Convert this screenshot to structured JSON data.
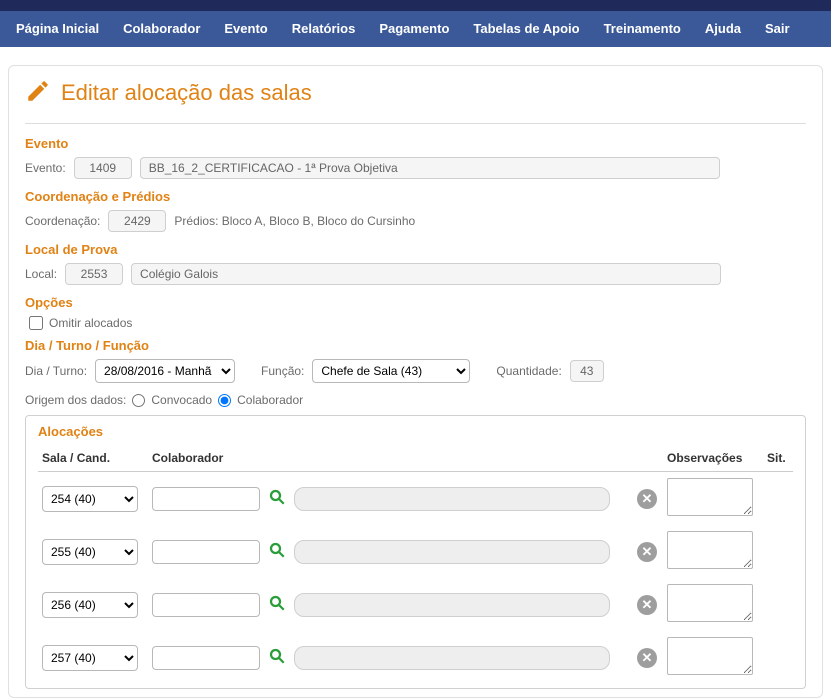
{
  "nav": {
    "items": [
      {
        "label": "Página Inicial"
      },
      {
        "label": "Colaborador"
      },
      {
        "label": "Evento"
      },
      {
        "label": "Relatórios"
      },
      {
        "label": "Pagamento"
      },
      {
        "label": "Tabelas de Apoio"
      },
      {
        "label": "Treinamento"
      },
      {
        "label": "Ajuda"
      },
      {
        "label": "Sair"
      }
    ]
  },
  "page": {
    "title": "Editar alocação das salas"
  },
  "evento": {
    "section": "Evento",
    "label": "Evento:",
    "id": "1409",
    "nome": "BB_16_2_CERTIFICACAO - 1ª Prova Objetiva"
  },
  "coord": {
    "section": "Coordenação e Prédios",
    "label": "Coordenação:",
    "id": "2429",
    "predios_label": "Prédios: Bloco A, Bloco B, Bloco do Cursinho"
  },
  "local": {
    "section": "Local de Prova",
    "label": "Local:",
    "id": "2553",
    "nome": "Colégio Galois"
  },
  "opcoes": {
    "section": "Opções",
    "omitir_label": "Omitir alocados"
  },
  "dia_turno": {
    "section": "Dia / Turno / Função",
    "label": "Dia / Turno:",
    "value": "28/08/2016 - Manhã",
    "funcao_label": "Função:",
    "funcao_value": "Chefe de Sala (43)",
    "qtd_label": "Quantidade:",
    "qtd_value": "43"
  },
  "origem": {
    "label": "Origem dos dados:",
    "opt1": "Convocado",
    "opt2": "Colaborador"
  },
  "alloc": {
    "title": "Alocações",
    "headers": {
      "sala": "Sala / Cand.",
      "colab": "Colaborador",
      "obs": "Observações",
      "sit": "Sit."
    },
    "rows": [
      {
        "sala": "254 (40)",
        "colab_id": "",
        "colab_nome": "",
        "obs": ""
      },
      {
        "sala": "255 (40)",
        "colab_id": "",
        "colab_nome": "",
        "obs": ""
      },
      {
        "sala": "256 (40)",
        "colab_id": "",
        "colab_nome": "",
        "obs": ""
      },
      {
        "sala": "257 (40)",
        "colab_id": "",
        "colab_nome": "",
        "obs": ""
      }
    ]
  }
}
